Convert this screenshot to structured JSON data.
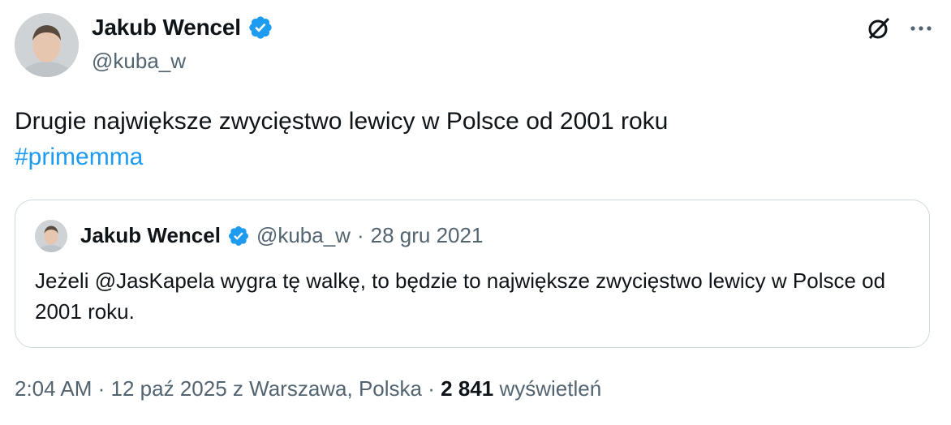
{
  "author": {
    "name": "Jakub Wencel",
    "handle": "@kuba_w"
  },
  "tweet": {
    "text": "Drugie największe zwycięstwo lewicy w Polsce od 2001 roku",
    "hashtag": "#primemma"
  },
  "quote": {
    "name": "Jakub Wencel",
    "handle": "@kuba_w",
    "separator": "·",
    "date": "28 gru 2021",
    "text": "Jeżeli @JasKapela wygra tę walkę, to będzie to największe zwycięstwo lewicy w Polsce od 2001 roku."
  },
  "footer": {
    "time": "2:04 AM",
    "date": "12 paź 2025",
    "location": "z Warszawa, Polska",
    "views_count": "2 841",
    "views_label": "wyświetleń"
  },
  "colors": {
    "accent": "#1d9bf0",
    "text": "#0f1419",
    "muted": "#536471",
    "border": "#cfd9de"
  },
  "icons": [
    "verified-badge-icon",
    "grok-icon",
    "more-icon"
  ]
}
